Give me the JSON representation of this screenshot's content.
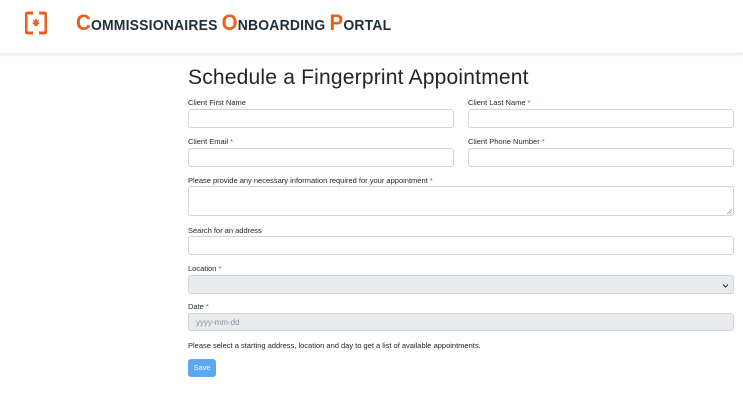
{
  "header": {
    "logo_icon": "commissionaires-maple-leaf-icon",
    "brand_parts": [
      {
        "cap": "C",
        "rest": "OMMISSIONAIRES "
      },
      {
        "cap": "O",
        "rest": "NBOARDING "
      },
      {
        "cap": "P",
        "rest": "ORTAL"
      }
    ],
    "brand_accent_color": "#e8601c",
    "brand_text_color": "#1f2d3d"
  },
  "form": {
    "title": "Schedule a Fingerprint Appointment",
    "first_name": {
      "label": "Client First Name",
      "value": ""
    },
    "last_name": {
      "label": "Client Last Name",
      "required_mark": "*",
      "value": ""
    },
    "email": {
      "label": "Client Email",
      "required_mark": "*",
      "value": ""
    },
    "phone": {
      "label": "Client Phone Number",
      "required_mark": "*",
      "value": ""
    },
    "info": {
      "label": "Please provide any necessary information required for your appointment",
      "required_mark": "*",
      "value": ""
    },
    "address": {
      "label": "Search for an address",
      "value": ""
    },
    "location": {
      "label": "Location",
      "required_mark": "*",
      "selected": ""
    },
    "date": {
      "label": "Date",
      "required_mark": "*",
      "placeholder": "yyyy-mm-dd"
    },
    "hint": "Please select a starting address, location and day to get a list of available appointments.",
    "save_label": "Save"
  }
}
